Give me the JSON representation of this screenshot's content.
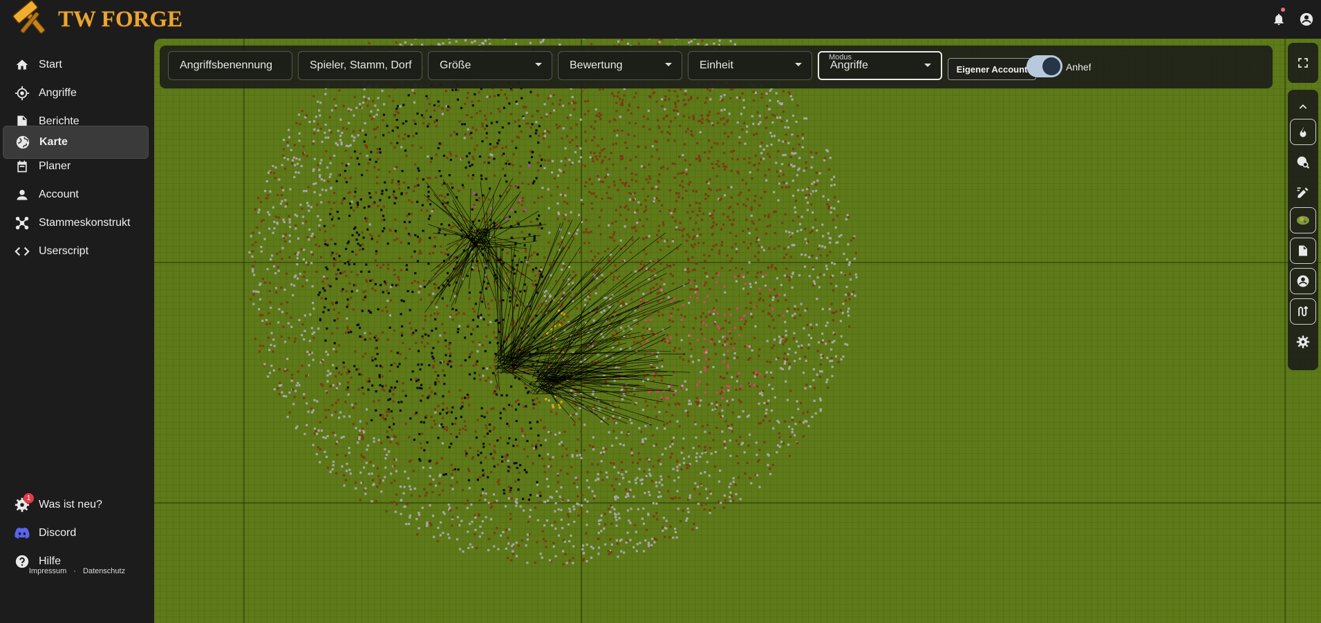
{
  "app": {
    "title": "TW FORGE"
  },
  "header": {
    "notifications_icon": "bell-icon",
    "account_icon": "account-circle-icon"
  },
  "sidebar": {
    "items": [
      {
        "label": "Start",
        "icon": "home-icon"
      },
      {
        "label": "Angriffe",
        "icon": "crosshair-icon"
      },
      {
        "label": "Berichte",
        "icon": "report-icon"
      },
      {
        "label": "Karte",
        "icon": "globe-icon",
        "active": true
      },
      {
        "label": "Planer",
        "icon": "calendar-icon"
      },
      {
        "label": "Account",
        "icon": "person-icon"
      },
      {
        "label": "Stammeskonstrukt",
        "icon": "network-icon"
      },
      {
        "label": "Userscript",
        "icon": "code-icon"
      }
    ],
    "bottom_items": [
      {
        "label": "Was ist neu?",
        "icon": "gear-news-icon",
        "badge": "1"
      },
      {
        "label": "Discord",
        "icon": "discord-icon"
      },
      {
        "label": "Hilfe",
        "icon": "help-icon"
      }
    ],
    "footer": {
      "impressum": "Impressum",
      "separator": "·",
      "datenschutz": "Datenschutz"
    }
  },
  "filters": {
    "angriffsbenennung": "Angriffsbenennung",
    "spieler": "Spieler, Stamm, Dorf",
    "groesse": "Größe",
    "bewertung": "Bewertung",
    "einheit": "Einheit",
    "modus_label": "Modus",
    "modus_value": "Angriffe",
    "own_account": "Eigener Account",
    "pin_label": "Anheften",
    "pin_on": true
  },
  "tools": [
    "chevron-up-icon",
    "fire-icon",
    "globe-search-icon",
    "edit-area-icon",
    "map-thumbnail-icon",
    "report-icon",
    "account-circle-icon",
    "route-icon",
    "settings-icon"
  ],
  "colors": {
    "map_bg": "#5e7a19",
    "grey_village": "#a7a7a7",
    "barbarian": "#7a3c0f",
    "own": "#0d0d0d",
    "tribe_magenta": "#c043c8",
    "tribe_pink": "#d9426e",
    "tribe_yellow": "#e8a414",
    "attack_line": "#000000",
    "logo": "#e9a531"
  }
}
